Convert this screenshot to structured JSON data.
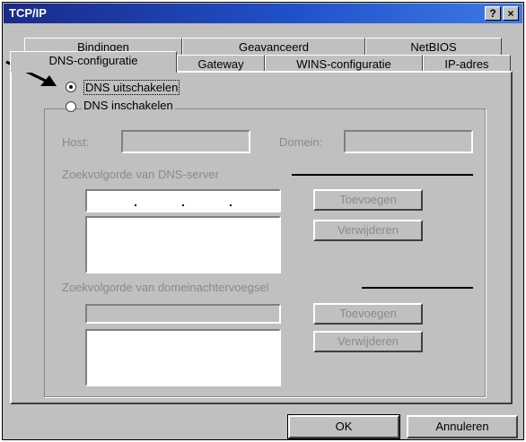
{
  "window": {
    "title": "TCP/IP",
    "help_button": "?",
    "close_button": "×"
  },
  "tabs_back": [
    "Bindingen",
    "Geavanceerd",
    "NetBIOS"
  ],
  "tabs_front": [
    "DNS-configuratie",
    "Gateway",
    "WINS-configuratie",
    "IP-adres"
  ],
  "dns": {
    "disable_label": "DNS uitschakelen",
    "enable_label": "DNS inschakelen",
    "selected": "disable"
  },
  "host": {
    "label": "Host:",
    "value": ""
  },
  "domain": {
    "label": "Domein:",
    "value": ""
  },
  "dns_server_order": {
    "label": "Zoekvolgorde van DNS-server",
    "add_button": "Toevoegen",
    "remove_button": "Verwijderen"
  },
  "domain_suffix_order": {
    "label": "Zoekvolgorde van domeinachtervoegsel",
    "add_button": "Toevoegen",
    "remove_button": "Verwijderen"
  },
  "footer": {
    "ok": "OK",
    "cancel": "Annuleren"
  }
}
